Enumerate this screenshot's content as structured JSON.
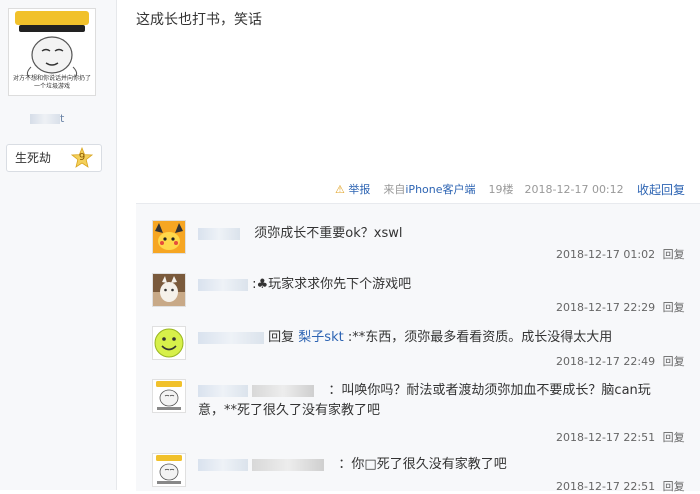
{
  "author": {
    "avatar_text_top": "WORLD",
    "avatar_text_bottom": "对方不想和你说话并向你扔了一个垃圾游戏",
    "name_suffix": "t",
    "level_name": "生死劫",
    "level_number": "9"
  },
  "post": {
    "content": "这成长也打书，笑话",
    "report_icon": "warning-icon",
    "report_label": "举报",
    "client_label": "来自iPhone客户端",
    "floor": "19楼",
    "time": "2018-12-17 00:12",
    "collapse_label": "收起回复"
  },
  "replies": [
    {
      "avatar": "pikachu-avatar",
      "text": "须弥成长不重要ok？xswl",
      "time": "2018-12-17 01:02",
      "reply_label": "回复"
    },
    {
      "avatar": "cat-avatar",
      "text": ":♣玩家求求你先下个游戏吧",
      "time": "2018-12-17 22:29",
      "reply_label": "回复"
    },
    {
      "avatar": "smiley-avatar",
      "prefix": "回复",
      "to": "梨子skt",
      "text": ":**东西，须弥最多看看资质。成长没得太大用",
      "time": "2018-12-17 22:49",
      "reply_label": "回复"
    },
    {
      "avatar": "meme-avatar",
      "text": "：叫唤你吗？耐法或者渡劫须弥加血不要成长？脑can玩",
      "text2": "意，**死了很久了没有家教了吧",
      "time": "2018-12-17 22:51",
      "reply_label": "回复"
    },
    {
      "avatar": "meme-avatar",
      "text": "：你□死了很久没有家教了吧",
      "time": "2018-12-17 22:51",
      "reply_label": "回复"
    }
  ],
  "colors": {
    "link": "#2d64b3",
    "panel_bg": "#f7f8fa",
    "meta": "#999999"
  }
}
